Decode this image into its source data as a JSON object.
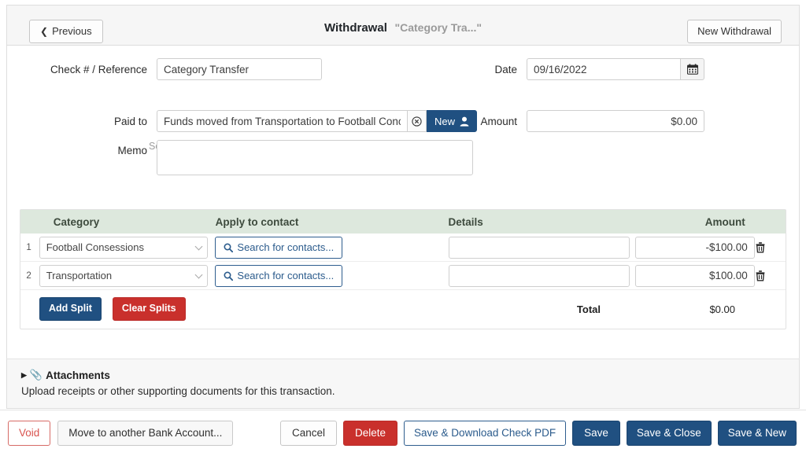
{
  "header": {
    "previous_label": "Previous",
    "title": "Withdrawal",
    "subtitle": "\"Category Tra...\"",
    "new_withdrawal_label": "New Withdrawal"
  },
  "form": {
    "check_label": "Check # / Reference",
    "check_value": "Category Transfer",
    "date_label": "Date",
    "date_value": "09/16/2022",
    "date_icon": "calendar-icon",
    "paid_hint": "Search for contacts or enter any name/description.",
    "paid_label": "Paid to",
    "paid_value": "Funds moved from Transportation to Football Concessions",
    "clear_icon": "clear-circle-icon",
    "new_contact_label": "New",
    "new_contact_icon": "user-icon",
    "amount_label": "Amount",
    "amount_value": "$0.00",
    "memo_label": "Memo",
    "memo_value": ""
  },
  "splits": {
    "columns": [
      "Category",
      "Apply to contact",
      "Details",
      "Amount"
    ],
    "rows": [
      {
        "index": "1",
        "category": "Football Consessions",
        "contact_button": "Search for contacts...",
        "contact_icon": "search-icon",
        "details": "",
        "amount": "-$100.00",
        "delete_icon": "trash-icon"
      },
      {
        "index": "2",
        "category": "Transportation",
        "contact_button": "Search for contacts...",
        "contact_icon": "search-icon",
        "details": "",
        "amount": "$100.00",
        "delete_icon": "trash-icon"
      }
    ],
    "add_split_label": "Add Split",
    "clear_splits_label": "Clear Splits",
    "total_label": "Total",
    "total_value": "$0.00"
  },
  "attachments": {
    "caret_icon": "caret-right-icon",
    "clip_icon": "paperclip-icon",
    "title": "Attachments",
    "description": "Upload receipts or other supporting documents for this transaction."
  },
  "footer": {
    "void_label": "Void",
    "move_label": "Move to another Bank Account...",
    "cancel_label": "Cancel",
    "delete_label": "Delete",
    "pdf_label": "Save & Download Check PDF",
    "save_label": "Save",
    "save_close_label": "Save & Close",
    "save_new_label": "Save & New"
  },
  "colors": {
    "primary": "#205081",
    "danger": "#c9302c",
    "void": "#d9534f",
    "table_header": "#dde8dd",
    "panel_bg": "#f6f6f6"
  }
}
